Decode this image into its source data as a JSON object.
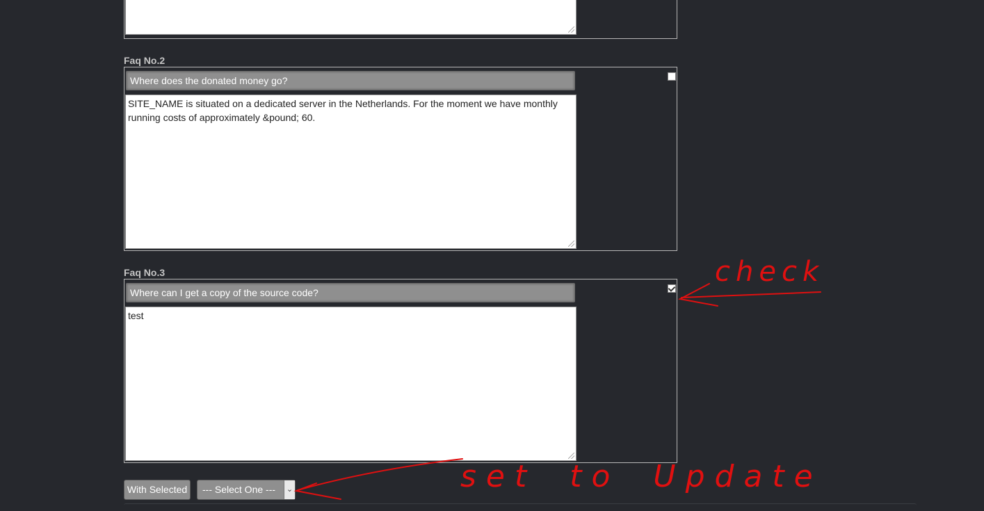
{
  "faqs": [
    {
      "label": "Faq No.2",
      "question": "Where does the donated money go?",
      "answer": "SITE_NAME is situated on a dedicated server in the Netherlands. For the moment we have monthly running costs of approximately &pound; 60.",
      "checked": false
    },
    {
      "label": "Faq No.3",
      "question": "Where can I get a copy of the source code?",
      "answer": "test",
      "checked": true
    }
  ],
  "actions": {
    "with_selected_label": "With Selected",
    "select_value": "--- Select One ---"
  },
  "annotations": {
    "check": "check",
    "set_to_update": "set to Update",
    "color": "#e01010"
  }
}
